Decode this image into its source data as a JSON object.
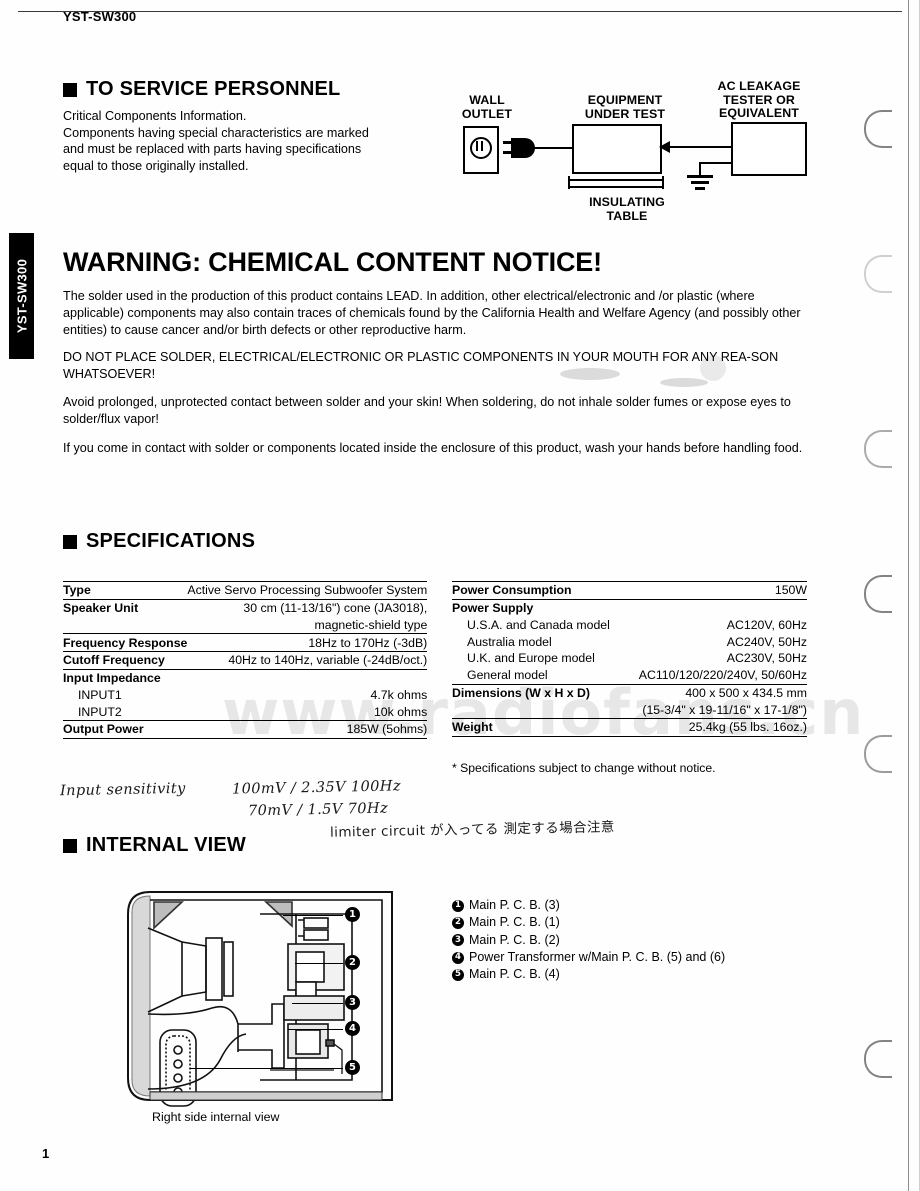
{
  "document": {
    "model": "YST-SW300",
    "side_tab": "YST-SW300",
    "page_number": "1",
    "watermark": "www.radiofans.cn"
  },
  "service_section": {
    "heading": "TO SERVICE PERSONNEL",
    "lines": [
      "Critical Components Information.",
      "Components having special characteristics are marked",
      "and must be replaced with parts having specifications",
      "equal to those originally installed."
    ]
  },
  "leakage_diagram": {
    "labels": {
      "wall_outlet": "WALL\nOUTLET",
      "equipment_under_test": "EQUIPMENT\nUNDER TEST",
      "ac_leakage_tester": "AC LEAKAGE\nTESTER OR\nEQUIVALENT",
      "insulating_table": "INSULATING\nTABLE"
    }
  },
  "warning": {
    "title": "WARNING: CHEMICAL CONTENT NOTICE!",
    "paragraphs": [
      "The solder used in the production of this product contains LEAD.  In addition, other electrical/electronic and /or plastic (where applicable) components may also contain traces of chemicals found by the California Health and Welfare Agency (and possibly other entities) to cause cancer and/or birth defects or other reproductive harm.",
      "DO NOT PLACE SOLDER, ELECTRICAL/ELECTRONIC OR PLASTIC COMPONENTS IN YOUR MOUTH FOR ANY REA-SON WHATSOEVER!",
      "Avoid prolonged, unprotected contact between solder and your skin!  When soldering, do not inhale solder fumes or expose eyes to solder/flux vapor!",
      "If you come in contact with solder or components located inside the enclosure of this product, wash your hands before handling food."
    ]
  },
  "specifications": {
    "heading": "SPECIFICATIONS",
    "left_rows": [
      {
        "label": "Type",
        "value": "Active Servo Processing Subwoofer System",
        "type": "main"
      },
      {
        "label": "Speaker Unit",
        "value": "30 cm (11-13/16\") cone (JA3018),",
        "type": "main"
      },
      {
        "label": "",
        "value": "magnetic-shield type",
        "type": "cont"
      },
      {
        "label": "Frequency Response",
        "value": "18Hz to 170Hz (-3dB)",
        "type": "main"
      },
      {
        "label": "Cutoff Frequency",
        "value": "40Hz to 140Hz, variable (-24dB/oct.)",
        "type": "main"
      },
      {
        "label": "Input Impedance",
        "value": "",
        "type": "main"
      },
      {
        "label": "INPUT1",
        "value": "4.7k ohms",
        "type": "sub"
      },
      {
        "label": "INPUT2",
        "value": "10k ohms",
        "type": "sub"
      },
      {
        "label": "Output Power",
        "value": "185W (5ohms)",
        "type": "main"
      }
    ],
    "right_rows": [
      {
        "label": "Power Consumption",
        "value": "150W",
        "type": "main"
      },
      {
        "label": "Power Supply",
        "value": "",
        "type": "main"
      },
      {
        "label": "U.S.A. and Canada model",
        "value": "AC120V, 60Hz",
        "type": "sub"
      },
      {
        "label": "Australia model",
        "value": "AC240V, 50Hz",
        "type": "sub"
      },
      {
        "label": "U.K. and Europe model",
        "value": "AC230V, 50Hz",
        "type": "sub"
      },
      {
        "label": "General model",
        "value": "AC110/120/220/240V, 50/60Hz",
        "type": "sub"
      },
      {
        "label": "Dimensions (W x H x D)",
        "value": "400 x 500 x 434.5 mm",
        "type": "main"
      },
      {
        "label": "",
        "value": "(15-3/4\" x 19-11/16\" x 17-1/8\")",
        "type": "cont"
      },
      {
        "label": "Weight",
        "value": "25.4kg (55 lbs. 16oz.)",
        "type": "main"
      }
    ],
    "footnote": "* Specifications subject to change without notice."
  },
  "handwritten_notes": {
    "line1": "Input sensitivity",
    "line2": "100mV / 2.35V  100Hz",
    "line3": "70mV / 1.5V    70Hz",
    "line4": "limiter circuit が入ってる 測定する場合注意"
  },
  "internal_view": {
    "heading": "INTERNAL VIEW",
    "caption": "Right side internal view",
    "callouts": [
      "1",
      "2",
      "3",
      "4",
      "5"
    ],
    "legend": [
      {
        "num": "1",
        "text": "Main P. C. B. (3)"
      },
      {
        "num": "2",
        "text": "Main P. C. B. (1)"
      },
      {
        "num": "3",
        "text": "Main P. C. B. (2)"
      },
      {
        "num": "4",
        "text": "Power Transformer w/Main P. C. B. (5) and (6)"
      },
      {
        "num": "5",
        "text": "Main P. C. B. (4)"
      }
    ]
  }
}
